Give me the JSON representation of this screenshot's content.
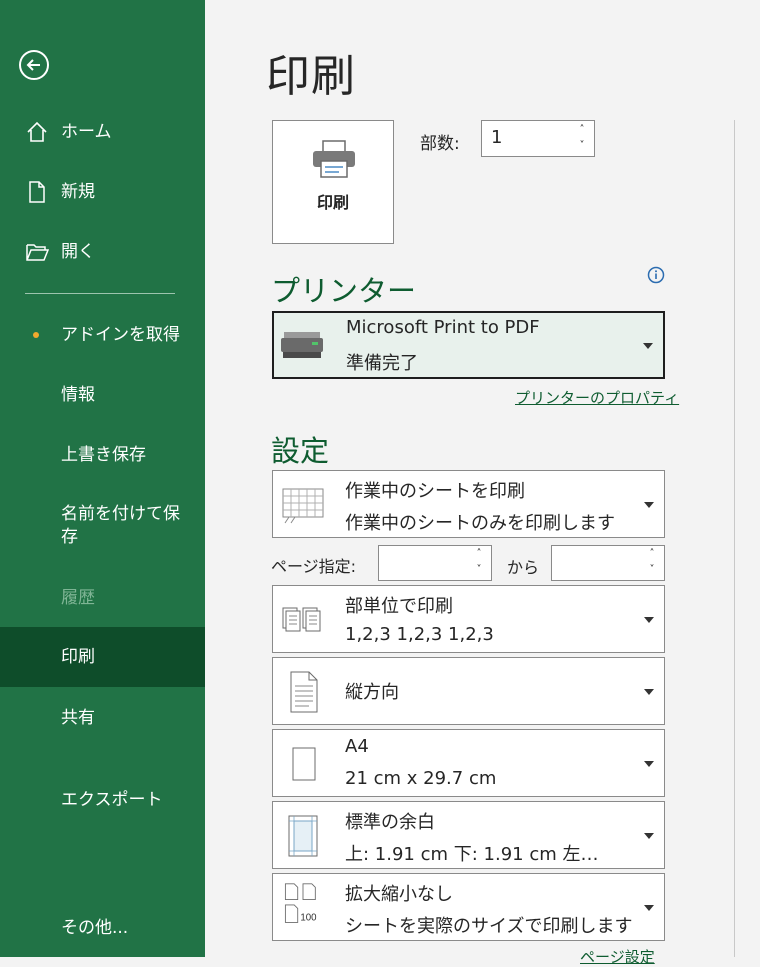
{
  "sidebar": {
    "items": [
      {
        "label": "ホーム"
      },
      {
        "label": "新規"
      },
      {
        "label": "開く"
      },
      {
        "label": "アドインを取得"
      },
      {
        "label": "情報"
      },
      {
        "label": "上書き保存"
      },
      {
        "label": "名前を付けて保存"
      },
      {
        "label": "履歴"
      },
      {
        "label": "印刷"
      },
      {
        "label": "共有"
      },
      {
        "label": "エクスポート"
      },
      {
        "label": "その他..."
      }
    ]
  },
  "main": {
    "title": "印刷",
    "print_button": "印刷",
    "copies_label": "部数:",
    "copies_value": "1",
    "printer_heading": "プリンター",
    "printer": {
      "name": "Microsoft Print to PDF",
      "status": "準備完了"
    },
    "printer_properties": "プリンターのプロパティ",
    "settings_heading": "設定",
    "pages_label": "ページ指定:",
    "pages_to": "から",
    "settings": [
      {
        "line1": "作業中のシートを印刷",
        "line2": "作業中のシートのみを印刷します"
      },
      {
        "line1": "部単位で印刷",
        "line2": "1,2,3    1,2,3    1,2,3"
      },
      {
        "line1": "縦方向",
        "line2": ""
      },
      {
        "line1": "A4",
        "line2": "21 cm x 29.7 cm"
      },
      {
        "line1": "標準の余白",
        "line2": "上: 1.91 cm 下: 1.91 cm 左…"
      },
      {
        "line1": "拡大縮小なし",
        "line2": "シートを実際のサイズで印刷します"
      }
    ],
    "scale_icon_text": "100",
    "page_setup": "ページ設定"
  },
  "colors": {
    "sidebar": "#217346",
    "sidebar_active": "#0e4d2a",
    "accent": "#0e5c30"
  }
}
